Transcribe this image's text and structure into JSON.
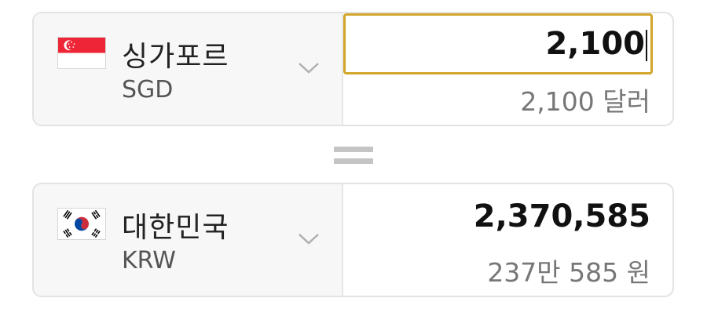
{
  "from": {
    "country": "싱가포르",
    "code": "SGD",
    "flag_icon": "singapore-flag-icon",
    "amount": "2,100",
    "amount_words": "2,100 달러"
  },
  "to": {
    "country": "대한민국",
    "code": "KRW",
    "flag_icon": "south-korea-flag-icon",
    "amount": "2,370,585",
    "amount_words": "237만 585 원"
  },
  "colors": {
    "input_border": "#d4a52b",
    "pane_bg": "#f7f7f7",
    "equals_sign": "#c4c4c4"
  }
}
